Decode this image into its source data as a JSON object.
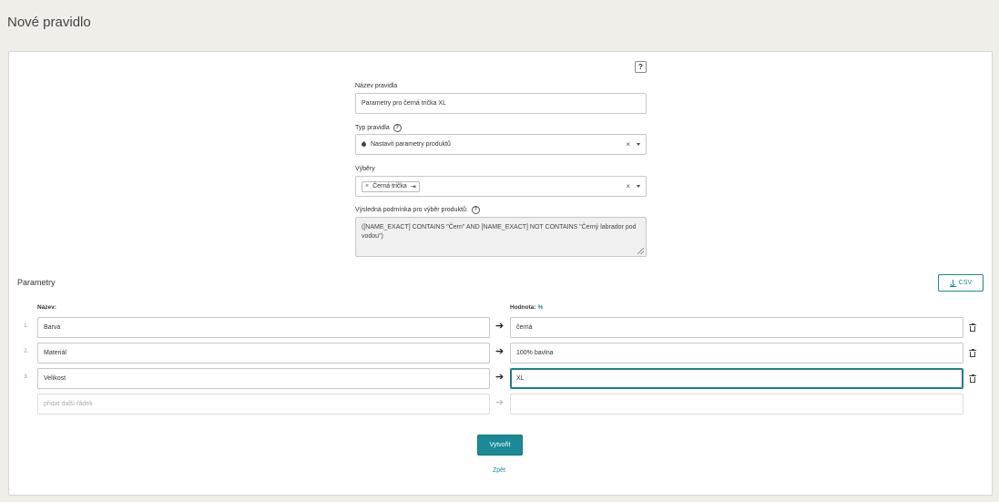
{
  "page": {
    "title": "Nové pravidlo"
  },
  "help_button": "?",
  "form": {
    "name": {
      "label": "Název pravidla",
      "value": "Parametry pro černá trička XL"
    },
    "type": {
      "label": "Typ pravidla",
      "value": "Nastavit parametry produktů"
    },
    "selections": {
      "label": "Výběry",
      "chip": "Černá trička"
    },
    "condition": {
      "label": "Výsledná podmínka pro výběr produktů:",
      "value": "([NAME_EXACT] CONTAINS \"Čern\" AND [NAME_EXACT] NOT CONTAINS \"Černý labrador pod vodou\")"
    }
  },
  "parameters": {
    "title": "Parametry",
    "csv_label": "CSV",
    "name_header": "Název:",
    "value_header": "Hodnota:",
    "value_header_suffix": "%",
    "rows": [
      {
        "num": "1.",
        "name": "Barva",
        "value": "černá"
      },
      {
        "num": "2.",
        "name": "Materiál",
        "value": "100% bavlna"
      },
      {
        "num": "3.",
        "name": "Velikost",
        "value": "XL"
      }
    ],
    "add_placeholder": "přidat další řádek"
  },
  "actions": {
    "submit": "Vytvořit",
    "back": "Zpět"
  },
  "colors": {
    "accent": "#1a8a96",
    "background": "#f0eee9"
  }
}
